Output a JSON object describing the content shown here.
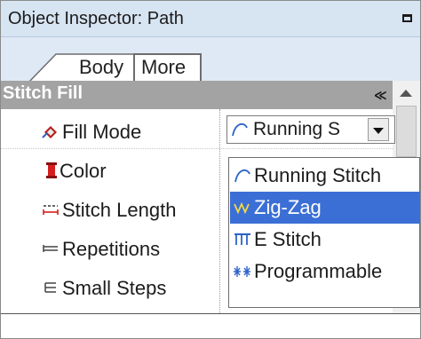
{
  "window": {
    "title": "Object Inspector: Path"
  },
  "tabs": [
    {
      "label": "Body",
      "active": false
    },
    {
      "label": "More",
      "active": true
    }
  ],
  "section": {
    "title": "Stitch Fill",
    "collapse_glyph": "»"
  },
  "properties": [
    {
      "label": "Fill Mode",
      "icon": "fill-mode-icon"
    },
    {
      "label": "Color",
      "icon": "spool-icon"
    },
    {
      "label": "Stitch Length",
      "icon": "stitch-length-icon"
    },
    {
      "label": "Repetitions",
      "icon": "repetitions-icon"
    },
    {
      "label": "Small Steps",
      "icon": "small-steps-icon"
    }
  ],
  "fill_mode_select": {
    "value": "Running Stitch",
    "display": "Running S"
  },
  "dropdown": {
    "options": [
      {
        "label": "Running Stitch",
        "icon": "running-stitch-icon",
        "selected": false
      },
      {
        "label": "Zig-Zag",
        "icon": "zigzag-icon",
        "selected": true
      },
      {
        "label": "E Stitch",
        "icon": "e-stitch-icon",
        "selected": false
      },
      {
        "label": "Programmable",
        "icon": "programmable-icon",
        "selected": false
      }
    ]
  },
  "colors": {
    "title_bg": "#d7e4f2",
    "section_header_bg": "#a3a3a3",
    "selection": "#3b6fd6"
  }
}
